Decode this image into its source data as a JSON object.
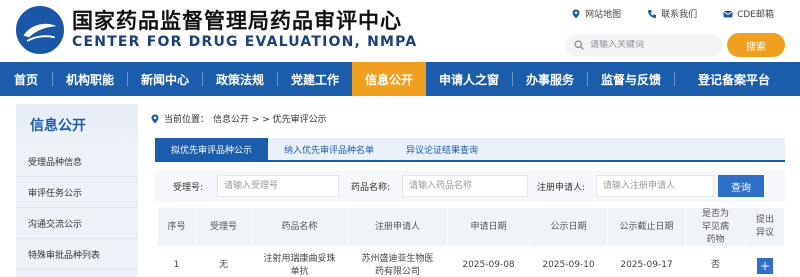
{
  "header": {
    "title_cn": "国家药品监督管理局药品审评中心",
    "title_en": "CENTER FOR DRUG EVALUATION, NMPA",
    "links": [
      {
        "label": "网站地图",
        "icon": "map-pin-icon"
      },
      {
        "label": "联系我们",
        "icon": "phone-icon"
      },
      {
        "label": "CDE邮箱",
        "icon": "mail-icon"
      }
    ],
    "search": {
      "placeholder": "请输入关键词",
      "button": "搜索"
    }
  },
  "nav": {
    "items": [
      "首页",
      "机构职能",
      "新闻中心",
      "政策法规",
      "党建工作",
      "信息公开",
      "申请人之窗",
      "办事服务",
      "监督与反馈",
      "登记备案平台"
    ],
    "active": "信息公开"
  },
  "sidebar": {
    "title": "信息公开",
    "items": [
      "受理品种信息",
      "审评任务公示",
      "沟通交流公示",
      "特殊审批品种列表"
    ]
  },
  "breadcrumb": {
    "prefix": "当前位置：",
    "path": "信息公开 > > 优先审评公示"
  },
  "tabs": [
    "拟优先审评品种公示",
    "纳入优先审评品种名单",
    "异议论证结果查询"
  ],
  "filter": {
    "fields": [
      {
        "label": "受理号:",
        "placeholder": "请输入受理号"
      },
      {
        "label": "药品名称:",
        "placeholder": "请输入药品名称"
      },
      {
        "label": "注册申请人:",
        "placeholder": "请输入注册申请人"
      }
    ],
    "query_button": "查询"
  },
  "table": {
    "headers": [
      "序号",
      "受理号",
      "药品名称",
      "注册申请人",
      "申请日期",
      "公示日期",
      "公示截止日期",
      "是否为罕见病药物",
      "提出异议"
    ],
    "rows": [
      {
        "index": "1",
        "acceptance_no": "无",
        "drug_name": "注射用瑞康曲妥珠单抗",
        "applicant": "苏州盛迪亚生物医药有限公司",
        "apply_date": "2025-09-08",
        "publish_date": "2025-09-10",
        "deadline": "2025-09-17",
        "rare_disease": "否",
        "objection": "+"
      }
    ]
  },
  "colors": {
    "primary": "#1b5cab",
    "accent": "#f0a020"
  }
}
